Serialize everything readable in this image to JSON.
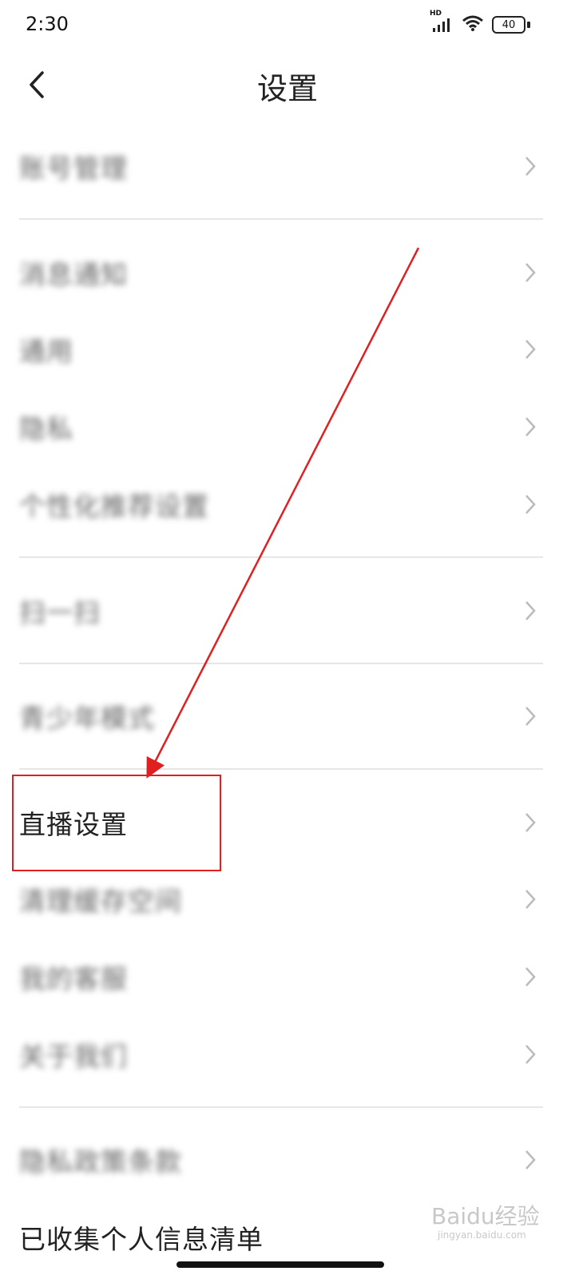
{
  "status": {
    "time": "2:30",
    "network": "HD",
    "battery": "40"
  },
  "header": {
    "title": "设置"
  },
  "settings": {
    "rows": [
      {
        "label": "账号管理",
        "blurred": true
      },
      {
        "label": "消息通知",
        "blurred": true
      },
      {
        "label": "通用",
        "blurred": true
      },
      {
        "label": "隐私",
        "blurred": true
      },
      {
        "label": "个性化推荐设置",
        "blurred": true
      },
      {
        "label": "扫一扫",
        "blurred": true
      },
      {
        "label": "青少年模式",
        "blurred": true
      },
      {
        "label": "直播设置",
        "blurred": false,
        "highlighted": true
      },
      {
        "label": "清理缓存空间",
        "blurred": true
      },
      {
        "label": "我的客服",
        "blurred": true
      },
      {
        "label": "关于我们",
        "blurred": true
      },
      {
        "label": "隐私政策条款",
        "blurred": true
      },
      {
        "label": "已收集个人信息清单",
        "blurred": false
      }
    ]
  },
  "annotation_color": "#e02020",
  "watermark": {
    "text": "Baidu经验",
    "sub": "jingyan.baidu.com"
  }
}
